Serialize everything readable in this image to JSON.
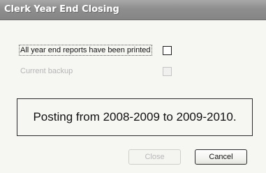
{
  "window": {
    "title": "Clerk Year End Closing"
  },
  "options": [
    {
      "label": "All year end reports have been printed",
      "checked": false,
      "enabled": true,
      "focused": true
    },
    {
      "label": "Current backup",
      "checked": false,
      "enabled": false,
      "focused": false
    }
  ],
  "message": "Posting from 2008-2009 to 2009-2010.",
  "buttons": {
    "close_label": "Close",
    "close_enabled": false,
    "cancel_label": "Cancel",
    "cancel_enabled": true
  },
  "colors": {
    "titlebar": "#8e8e8e",
    "client_bg": "#f6f6f3",
    "disabled_text": "#b5b5b5"
  }
}
